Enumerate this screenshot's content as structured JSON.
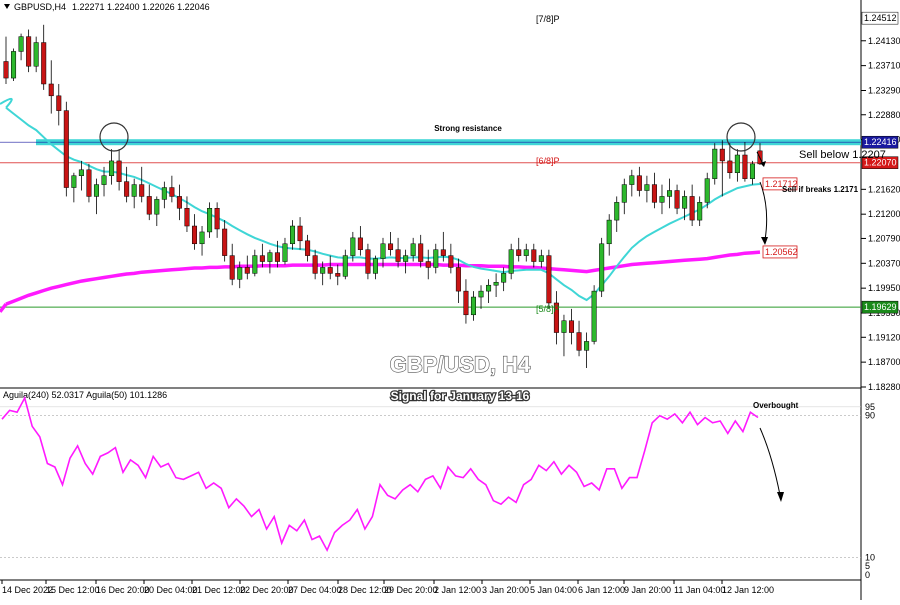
{
  "chart_data": [
    {
      "type": "candlestick",
      "symbol": "GBPUSD,H4",
      "ohlc": "1.22271 1.22400 1.22026 1.22046",
      "y_ticks": [
        "1.24130",
        "1.23710",
        "1.23290",
        "1.22880",
        "1.22460",
        "1.21620",
        "1.21200",
        "1.20790",
        "1.20370",
        "1.19950",
        "1.19530",
        "1.19120",
        "1.18700",
        "1.18280"
      ],
      "ylim": [
        1.1828,
        1.2465
      ],
      "x_labels": [
        "14 Dec 2022",
        "15 Dec 12:00",
        "16 Dec 20:00",
        "20 Dec 04:00",
        "21 Dec 12:00",
        "22 Dec 20:00",
        "27 Dec 04:00",
        "28 Dec 12:00",
        "29 Dec 20:00",
        "2 Jan 12:00",
        "3 Jan 20:00",
        "5 Jan 04:00",
        "6 Jan 12:00",
        "9 Jan 20:00",
        "11 Jan 04:00",
        "12 Jan 12:00"
      ],
      "price_labels": [
        {
          "text": "1.24512",
          "value": 1.24512,
          "color": "#000000"
        },
        {
          "text": "1.22416",
          "value": 1.22416,
          "color": "#1a1aa0"
        },
        {
          "text": "1.22070",
          "value": 1.2207,
          "color": "#d41818"
        },
        {
          "text": "1.21712",
          "value": 1.21712,
          "color": "#d41818"
        },
        {
          "text": "1.20562",
          "value": 1.20562,
          "color": "#d41818"
        },
        {
          "text": "1.19629",
          "value": 1.19629,
          "color": "#1a8a1a"
        }
      ],
      "levels": [
        {
          "label": "Strong resistance",
          "value": 1.22416,
          "color": "#3fd6d6"
        },
        {
          "label": "[6/8]P",
          "value": 1.2207,
          "color": "#e05050"
        },
        {
          "label": "",
          "value": 1.19629,
          "color": "#2a9a2a"
        }
      ],
      "murray_labels": [
        {
          "text": "[7/8]P",
          "value": 1.2451
        },
        {
          "text": "[5/8]P",
          "value": 1.1955
        }
      ],
      "annotations": [
        "Sell below 1.2207",
        "Sell if breaks 1.2171"
      ],
      "overlay_title": "GBP/USD, H4",
      "overlay_subtitle": "Signal for January 13-16",
      "candles": [
        [
          1.2378,
          1.242,
          1.234,
          1.235
        ],
        [
          1.235,
          1.24,
          1.2345,
          1.2395
        ],
        [
          1.2395,
          1.2425,
          1.238,
          1.242
        ],
        [
          1.242,
          1.2432,
          1.236,
          1.237
        ],
        [
          1.237,
          1.242,
          1.236,
          1.241
        ],
        [
          1.241,
          1.244,
          1.233,
          1.234
        ],
        [
          1.234,
          1.238,
          1.229,
          1.232
        ],
        [
          1.232,
          1.234,
          1.227,
          1.2295
        ],
        [
          1.2295,
          1.231,
          1.215,
          1.2165
        ],
        [
          1.2165,
          1.219,
          1.214,
          1.2185
        ],
        [
          1.2185,
          1.221,
          1.216,
          1.2195
        ],
        [
          1.2195,
          1.2205,
          1.214,
          1.215
        ],
        [
          1.215,
          1.218,
          1.212,
          1.217
        ],
        [
          1.217,
          1.22,
          1.215,
          1.2185
        ],
        [
          1.2185,
          1.223,
          1.217,
          1.221
        ],
        [
          1.221,
          1.223,
          1.216,
          1.2175
        ],
        [
          1.2175,
          1.22,
          1.214,
          1.215
        ],
        [
          1.215,
          1.218,
          1.213,
          1.217
        ],
        [
          1.217,
          1.22,
          1.214,
          1.215
        ],
        [
          1.215,
          1.217,
          1.211,
          1.212
        ],
        [
          1.212,
          1.215,
          1.21,
          1.2145
        ],
        [
          1.2145,
          1.2175,
          1.213,
          1.2165
        ],
        [
          1.2165,
          1.2185,
          1.214,
          1.215
        ],
        [
          1.215,
          1.217,
          1.211,
          1.213
        ],
        [
          1.213,
          1.215,
          1.209,
          1.21
        ],
        [
          1.21,
          1.212,
          1.206,
          1.207
        ],
        [
          1.207,
          1.21,
          1.205,
          1.209
        ],
        [
          1.209,
          1.214,
          1.208,
          1.213
        ],
        [
          1.213,
          1.214,
          1.208,
          1.2095
        ],
        [
          1.2095,
          1.211,
          1.204,
          1.205
        ],
        [
          1.205,
          1.207,
          1.2,
          1.201
        ],
        [
          1.201,
          1.204,
          1.1995,
          1.203
        ],
        [
          1.203,
          1.205,
          1.201,
          1.202
        ],
        [
          1.202,
          1.206,
          1.2015,
          1.205
        ],
        [
          1.205,
          1.207,
          1.203,
          1.204
        ],
        [
          1.204,
          1.206,
          1.202,
          1.2055
        ],
        [
          1.2055,
          1.2075,
          1.203,
          1.204
        ],
        [
          1.204,
          1.208,
          1.2035,
          1.207
        ],
        [
          1.207,
          1.211,
          1.206,
          1.21
        ],
        [
          1.21,
          1.2115,
          1.206,
          1.2075
        ],
        [
          1.2075,
          1.2085,
          1.204,
          1.205
        ],
        [
          1.205,
          1.206,
          1.201,
          1.202
        ],
        [
          1.202,
          1.204,
          1.2,
          1.203
        ],
        [
          1.203,
          1.205,
          1.201,
          1.202
        ],
        [
          1.202,
          1.2035,
          1.2,
          1.2015
        ],
        [
          1.2015,
          1.206,
          1.201,
          1.205
        ],
        [
          1.205,
          1.209,
          1.204,
          1.208
        ],
        [
          1.208,
          1.21,
          1.205,
          1.206
        ],
        [
          1.206,
          1.207,
          1.201,
          1.202
        ],
        [
          1.202,
          1.205,
          1.201,
          1.2045
        ],
        [
          1.2045,
          1.208,
          1.203,
          1.207
        ],
        [
          1.207,
          1.209,
          1.205,
          1.206
        ],
        [
          1.206,
          1.208,
          1.203,
          1.204
        ],
        [
          1.204,
          1.206,
          1.202,
          1.205
        ],
        [
          1.205,
          1.208,
          1.204,
          1.207
        ],
        [
          1.207,
          1.2085,
          1.203,
          1.204
        ],
        [
          1.204,
          1.206,
          1.201,
          1.203
        ],
        [
          1.203,
          1.207,
          1.202,
          1.206
        ],
        [
          1.206,
          1.209,
          1.204,
          1.205
        ],
        [
          1.205,
          1.207,
          1.202,
          1.203
        ],
        [
          1.203,
          1.2045,
          1.197,
          1.199
        ],
        [
          1.199,
          1.201,
          1.1935,
          1.195
        ],
        [
          1.195,
          1.199,
          1.194,
          1.198
        ],
        [
          1.198,
          1.2,
          1.196,
          1.199
        ],
        [
          1.199,
          1.201,
          1.197,
          1.2
        ],
        [
          1.2,
          1.202,
          1.198,
          1.2005
        ],
        [
          1.2005,
          1.203,
          1.199,
          1.202
        ],
        [
          1.202,
          1.207,
          1.201,
          1.206
        ],
        [
          1.206,
          1.208,
          1.204,
          1.205
        ],
        [
          1.205,
          1.207,
          1.204,
          1.206
        ],
        [
          1.206,
          1.207,
          1.203,
          1.204
        ],
        [
          1.204,
          1.206,
          1.203,
          1.205
        ],
        [
          1.205,
          1.206,
          1.196,
          1.197
        ],
        [
          1.197,
          1.199,
          1.19,
          1.192
        ],
        [
          1.192,
          1.195,
          1.188,
          1.194
        ],
        [
          1.194,
          1.196,
          1.19,
          1.192
        ],
        [
          1.192,
          1.194,
          1.188,
          1.189
        ],
        [
          1.189,
          1.192,
          1.186,
          1.1905
        ],
        [
          1.1905,
          1.2,
          1.19,
          1.199
        ],
        [
          1.199,
          1.208,
          1.198,
          1.207
        ],
        [
          1.207,
          1.212,
          1.205,
          1.211
        ],
        [
          1.211,
          1.215,
          1.209,
          1.214
        ],
        [
          1.214,
          1.218,
          1.212,
          1.217
        ],
        [
          1.217,
          1.2195,
          1.215,
          1.2185
        ],
        [
          1.2185,
          1.22,
          1.215,
          1.216
        ],
        [
          1.216,
          1.2185,
          1.214,
          1.217
        ],
        [
          1.217,
          1.219,
          1.213,
          1.214
        ],
        [
          1.214,
          1.217,
          1.212,
          1.215
        ],
        [
          1.215,
          1.218,
          1.213,
          1.216
        ],
        [
          1.216,
          1.217,
          1.212,
          1.213
        ],
        [
          1.213,
          1.216,
          1.211,
          1.215
        ],
        [
          1.215,
          1.217,
          1.21,
          1.211
        ],
        [
          1.211,
          1.215,
          1.21,
          1.214
        ],
        [
          1.214,
          1.219,
          1.213,
          1.218
        ],
        [
          1.218,
          1.224,
          1.217,
          1.223
        ],
        [
          1.223,
          1.2245,
          1.215,
          1.221
        ],
        [
          1.221,
          1.224,
          1.218,
          1.219
        ],
        [
          1.219,
          1.223,
          1.2175,
          1.222
        ],
        [
          1.222,
          1.2242,
          1.2175,
          1.218
        ],
        [
          1.218,
          1.221,
          1.217,
          1.2205
        ],
        [
          1.2227,
          1.224,
          1.2203,
          1.2205
        ]
      ],
      "sma_21": [
        1.23,
        1.229,
        1.228,
        1.227,
        1.2262,
        1.225,
        1.2238,
        1.2228,
        1.2218,
        1.2212,
        1.2208,
        1.2202,
        1.2196,
        1.2192,
        1.2192,
        1.219,
        1.2186,
        1.2183,
        1.2178,
        1.2172,
        1.2166,
        1.216,
        1.2154,
        1.2147,
        1.214,
        1.2132,
        1.2125,
        1.212,
        1.2114,
        1.2108,
        1.21,
        1.2093,
        1.2086,
        1.208,
        1.2075,
        1.207,
        1.2066,
        1.2063,
        1.2062,
        1.2061,
        1.206,
        1.2057,
        1.2053,
        1.205,
        1.2047,
        1.2046,
        1.2047,
        1.2047,
        1.2045,
        1.2045,
        1.2046,
        1.2047,
        1.2046,
        1.2046,
        1.2047,
        1.2047,
        1.2046,
        1.2047,
        1.2048,
        1.2047,
        1.2043,
        1.2036,
        1.2031,
        1.2028,
        1.2026,
        1.2024,
        1.2022,
        1.2024,
        1.2025,
        1.2026,
        1.2026,
        1.2026,
        1.202,
        1.201,
        1.2,
        1.1992,
        1.1982,
        1.1975,
        1.1985,
        1.2,
        1.2015,
        1.2032,
        1.2048,
        1.2063,
        1.2074,
        1.2083,
        1.209,
        1.2097,
        1.2104,
        1.211,
        1.2116,
        1.2122,
        1.2128,
        1.2136,
        1.2145,
        1.2152,
        1.2158,
        1.2164,
        1.2167,
        1.217,
        1.2171
      ],
      "sma_200": [
        1.1968,
        1.1973,
        1.1978,
        1.1983,
        1.1987,
        1.1991,
        1.1995,
        1.1998,
        1.2001,
        1.2004,
        1.2007,
        1.2009,
        1.2011,
        1.2013,
        1.2015,
        1.2017,
        1.2019,
        1.202,
        1.2022,
        1.2023,
        1.2024,
        1.2025,
        1.2026,
        1.2027,
        1.2028,
        1.2029,
        1.2029,
        1.203,
        1.203,
        1.2031,
        1.2031,
        1.2032,
        1.2032,
        1.2032,
        1.2033,
        1.2033,
        1.2033,
        1.2033,
        1.2034,
        1.2034,
        1.2034,
        1.2034,
        1.2034,
        1.2035,
        1.2035,
        1.2035,
        1.2035,
        1.2035,
        1.2035,
        1.2035,
        1.2035,
        1.2035,
        1.2035,
        1.2035,
        1.2035,
        1.2035,
        1.2035,
        1.2035,
        1.2034,
        1.2034,
        1.2034,
        1.2033,
        1.2033,
        1.2033,
        1.2032,
        1.2032,
        1.2032,
        1.2031,
        1.2031,
        1.203,
        1.203,
        1.2029,
        1.2028,
        1.2027,
        1.2026,
        1.2025,
        1.2024,
        1.2023,
        1.2025,
        1.2027,
        1.2029,
        1.2031,
        1.2033,
        1.2035,
        1.2036,
        1.2037,
        1.2038,
        1.2039,
        1.204,
        1.2041,
        1.2042,
        1.2043,
        1.2044,
        1.2045,
        1.2047,
        1.2049,
        1.2051,
        1.2052,
        1.2054,
        1.2055,
        1.2056
      ]
    },
    {
      "type": "line",
      "indicator_text": "Aguila(240) 52.0317  Aguila(50) 101.1286",
      "y_ticks": [
        "95",
        "90",
        "10",
        "5",
        "0"
      ],
      "ylim": [
        0,
        100
      ],
      "annotation": "Overbought",
      "series": [
        {
          "values": [
            88,
            93,
            92,
            100,
            84,
            78,
            63,
            61,
            51,
            66,
            73,
            63,
            57,
            67,
            69,
            72,
            58,
            65,
            62,
            55,
            67,
            61,
            63,
            55,
            54,
            56,
            58,
            49,
            52,
            49,
            38,
            43,
            39,
            33,
            37,
            26,
            33,
            18,
            28,
            25,
            31,
            20,
            22,
            14,
            24,
            28,
            31,
            37,
            26,
            33,
            51,
            45,
            43,
            48,
            51,
            47,
            54,
            56,
            49,
            61,
            56,
            55,
            60,
            54,
            51,
            42,
            40,
            44,
            41,
            51,
            54,
            62,
            59,
            64,
            57,
            62,
            58,
            50,
            52,
            48,
            60,
            60,
            49,
            55,
            55,
            70,
            86,
            90,
            88,
            91,
            86,
            92,
            85,
            89,
            86,
            87,
            80,
            87,
            81,
            92,
            89
          ]
        }
      ]
    }
  ]
}
